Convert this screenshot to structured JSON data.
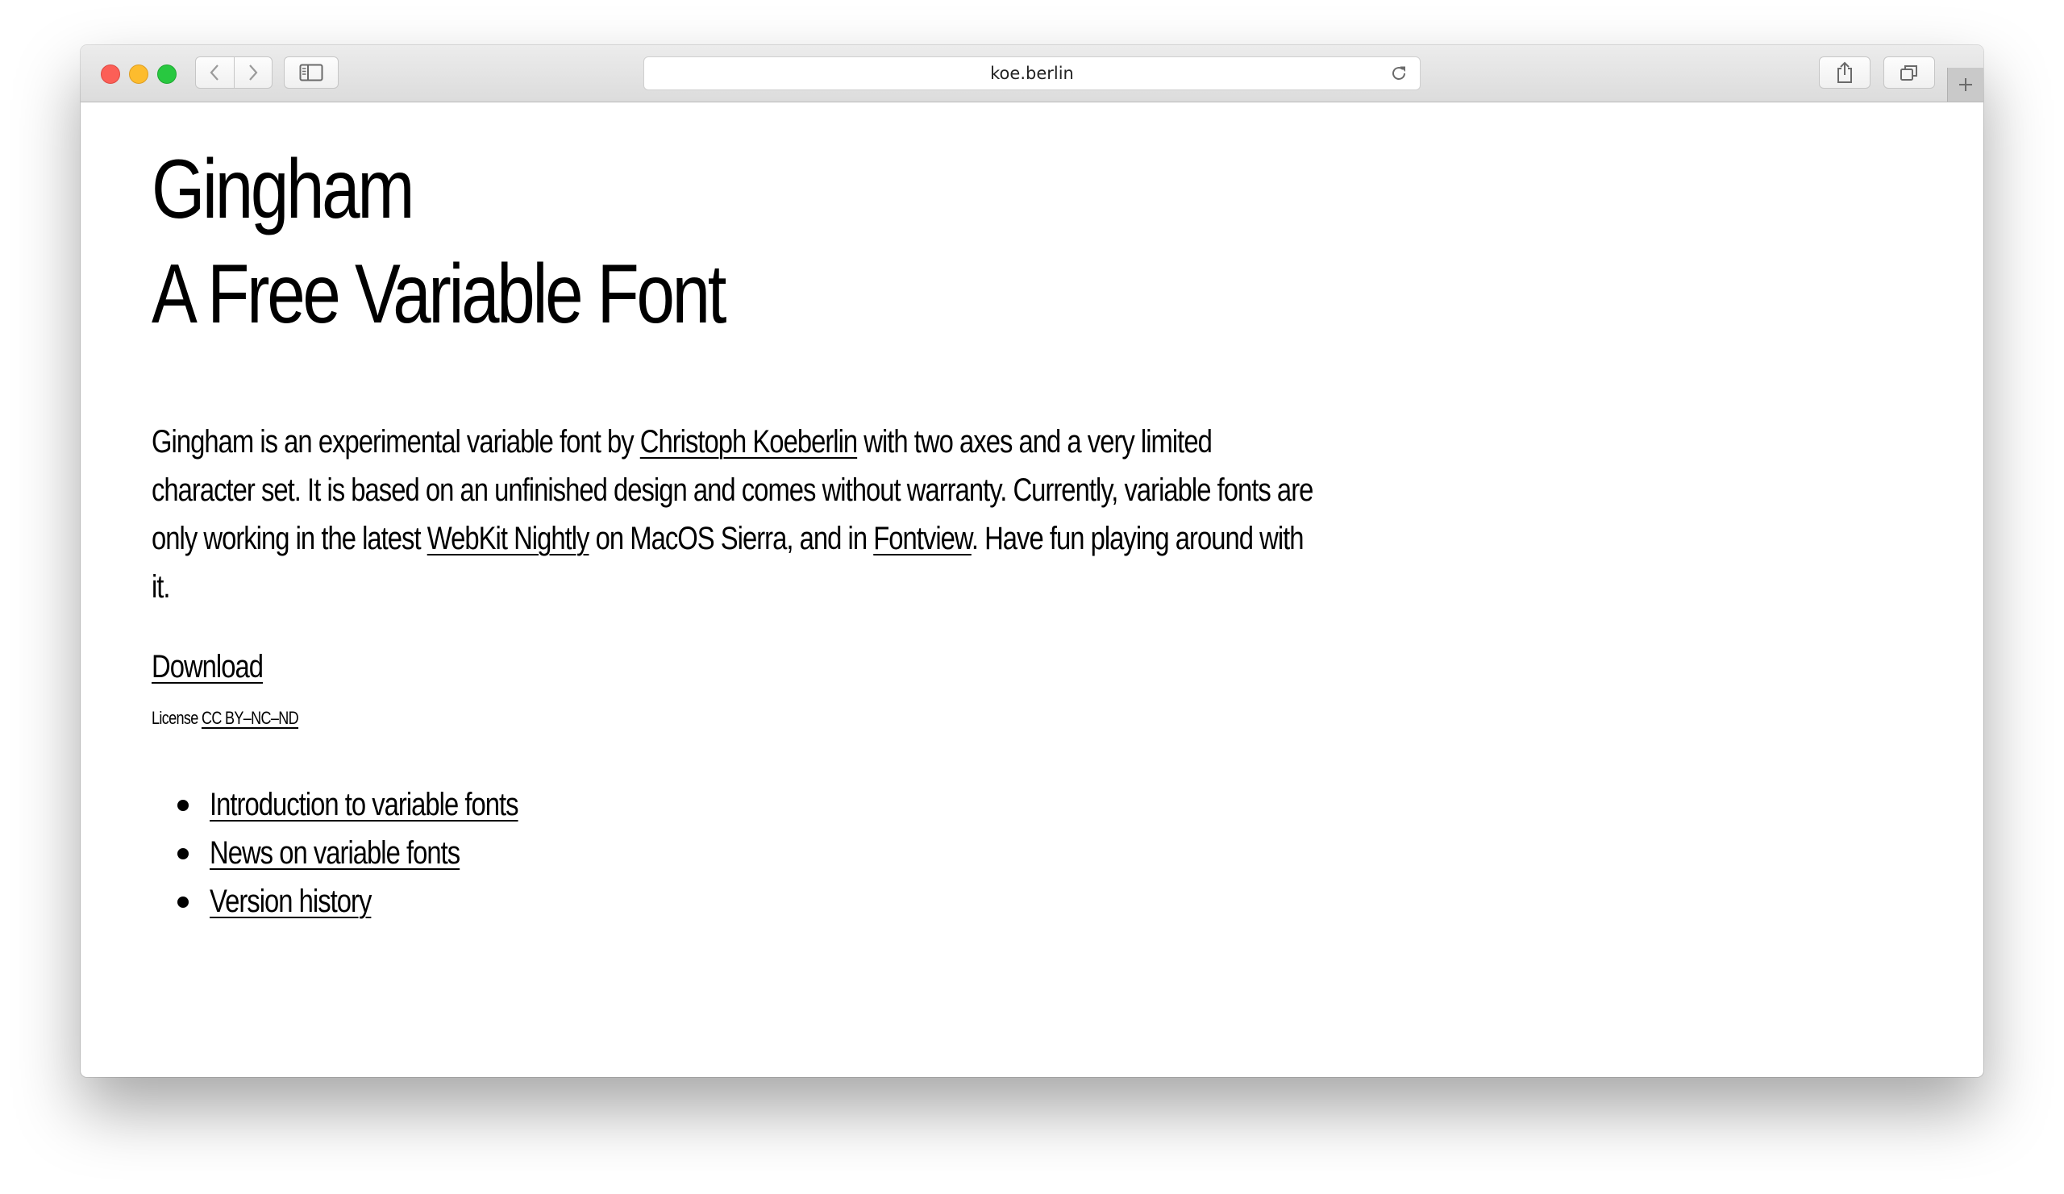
{
  "browser": {
    "url": "koe.berlin",
    "icons": {
      "back": "chevron-left-icon",
      "forward": "chevron-right-icon",
      "sidebar": "sidebar-icon",
      "reload": "reload-icon",
      "share": "share-icon",
      "tabs": "tabs-icon",
      "new_tab": "plus-icon"
    }
  },
  "page": {
    "title_line1": "Gingham",
    "title_line2": "A Free Variable Font",
    "intro": {
      "t1": "Gingham is an experimental variable font by ",
      "author_link": "Christoph Koeberlin",
      "t2": " with two axes and a very limited character set. It is based on an unfinished design and comes without warranty. Currently, variable fonts are only working in the latest ",
      "webkit_link": "WebKit Nightly",
      "t3": " on MacOS Sierra, and in ",
      "fontview_link": "Fontview",
      "t4": ". Have fun playing around with it."
    },
    "download_label": "Download",
    "license_label": "License",
    "license_link": "CC BY–NC–ND",
    "links": [
      "Introduction to variable fonts",
      "News on variable fonts",
      "Version history"
    ]
  }
}
